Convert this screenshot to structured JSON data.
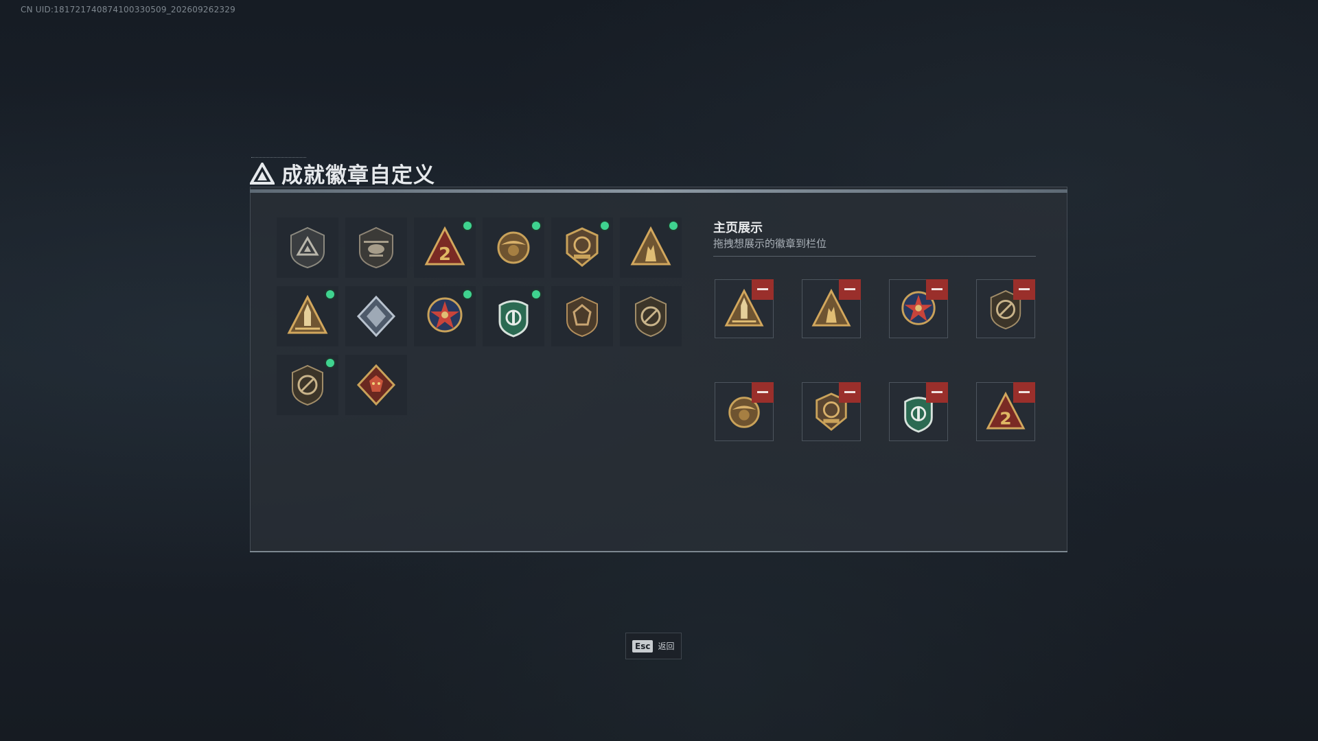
{
  "uid_text": "CN UID:181721740874100330509_202609262329",
  "dialog": {
    "title": "成就徽章自定义",
    "title_icon": "delta-triangle-logo-icon"
  },
  "badge_list": [
    {
      "icon": "triangle-shield-badge-icon",
      "new": false
    },
    {
      "icon": "helicopter-badge-icon",
      "new": false
    },
    {
      "icon": "number-2-triangle-badge-icon",
      "new": true
    },
    {
      "icon": "eagle-wreath-badge-icon",
      "new": true
    },
    {
      "icon": "2020-emblem-badge-icon",
      "new": true
    },
    {
      "icon": "soldiers-triangle-badge-icon",
      "new": true
    },
    {
      "icon": "rocket-triangle-badge-icon",
      "new": true
    },
    {
      "icon": "silver-diamond-badge-icon",
      "new": false
    },
    {
      "icon": "star-medal-badge-icon",
      "new": true
    },
    {
      "icon": "green-beret-shield-badge-icon",
      "new": true
    },
    {
      "icon": "bronze-shield-badge-icon",
      "new": false
    },
    {
      "icon": "no-weapon-shield-badge-icon",
      "new": false
    },
    {
      "icon": "no-weapon-shield-badge-icon",
      "new": true
    },
    {
      "icon": "dragon-diamond-badge-icon",
      "new": false
    }
  ],
  "showcase": {
    "title": "主页展示",
    "subtitle": "拖拽想展示的徽章到栏位",
    "slots": [
      {
        "icon": "rocket-triangle-badge-icon"
      },
      {
        "icon": "soldiers-triangle-badge-icon"
      },
      {
        "icon": "star-medal-badge-icon"
      },
      {
        "icon": "no-weapon-shield-badge-icon"
      },
      {
        "icon": "eagle-wreath-badge-icon"
      },
      {
        "icon": "2020-emblem-badge-icon"
      },
      {
        "icon": "green-beret-shield-badge-icon"
      },
      {
        "icon": "number-2-triangle-badge-icon"
      }
    ],
    "remove_icon": "minus-icon"
  },
  "footer": {
    "key": "Esc",
    "label": "返回"
  },
  "colors": {
    "new_dot": "#3fd38f",
    "remove": "#9a2f2b",
    "gold": "#c9a25a"
  }
}
